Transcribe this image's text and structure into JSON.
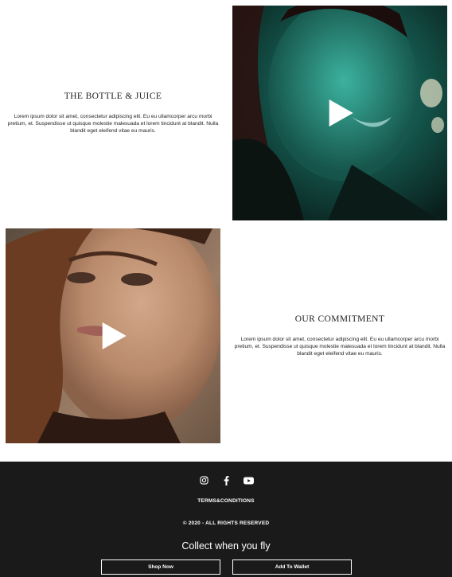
{
  "sections": [
    {
      "heading": "THE BOTTLE & JUICE",
      "body": "Lorem ipsum dolor sit amet, consectetur adipiscing elit. Eu eu ullamcorper arcu morbi pretium, et. Suspendisse ut quisque molestie malesuada et lorem tincidunt at blandit. Nulla blandit eget eleifend vitae eu mauris.",
      "video_icon": "play-icon"
    },
    {
      "heading": "OUR COMMITMENT",
      "body": "Lorem ipsum dolor sit amet, consectetur adipiscing elit. Eu eu ullamcorper arcu morbi pretium, et. Suspendisse ut quisque molestie malesuada et lorem tincidunt at blandit. Nulla blandit eget eleifend vitae eu mauris.",
      "video_icon": "play-icon"
    }
  ],
  "footer": {
    "social": [
      "instagram-icon",
      "facebook-icon",
      "youtube-icon"
    ],
    "terms": "TERMS&CONDITIONS",
    "copyright": "© 2020 - ALL RIGHTS RESERVED",
    "tagline": "Collect when you fly",
    "shop_button": "Shop Now",
    "wallet_button": "Add To Wallet"
  },
  "colors": {
    "footer_bg": "#1a1a1a",
    "text": "#222222"
  }
}
